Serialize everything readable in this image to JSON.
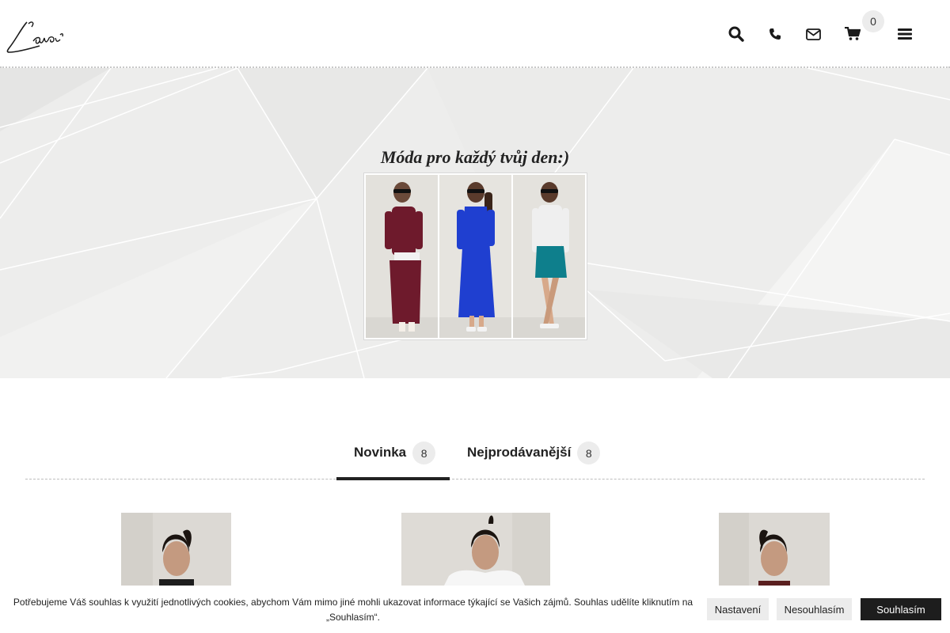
{
  "header": {
    "logo_text": "Lavi",
    "icons": [
      "search-icon",
      "phone-icon",
      "envelope-icon",
      "cart-icon",
      "menu-icon"
    ],
    "cart_count": "0"
  },
  "hero": {
    "title": "Móda pro každý tvůj den:)",
    "photos": [
      {
        "garment": "burgundy top and skirt",
        "color": "#6e1a2c"
      },
      {
        "garment": "royal blue dress",
        "color": "#1f3fd0"
      },
      {
        "garment": "white top teal skirt",
        "color": "#0e7f8c"
      }
    ]
  },
  "tabs": [
    {
      "label": "Novinka",
      "count": "8",
      "active": true
    },
    {
      "label": "Nejprodávanější",
      "count": "8",
      "active": false
    }
  ],
  "cookie": {
    "text": "Potřebujeme Váš souhlas k využití jednotlivých cookies, abychom Vám mimo jiné mohli ukazovat informace týkající se Vašich zájmů. Souhlas udělíte kliknutím na „Souhlasím“.",
    "settings_label": "Nastavení",
    "decline_label": "Nesouhlasím",
    "accept_label": "Souhlasím"
  }
}
